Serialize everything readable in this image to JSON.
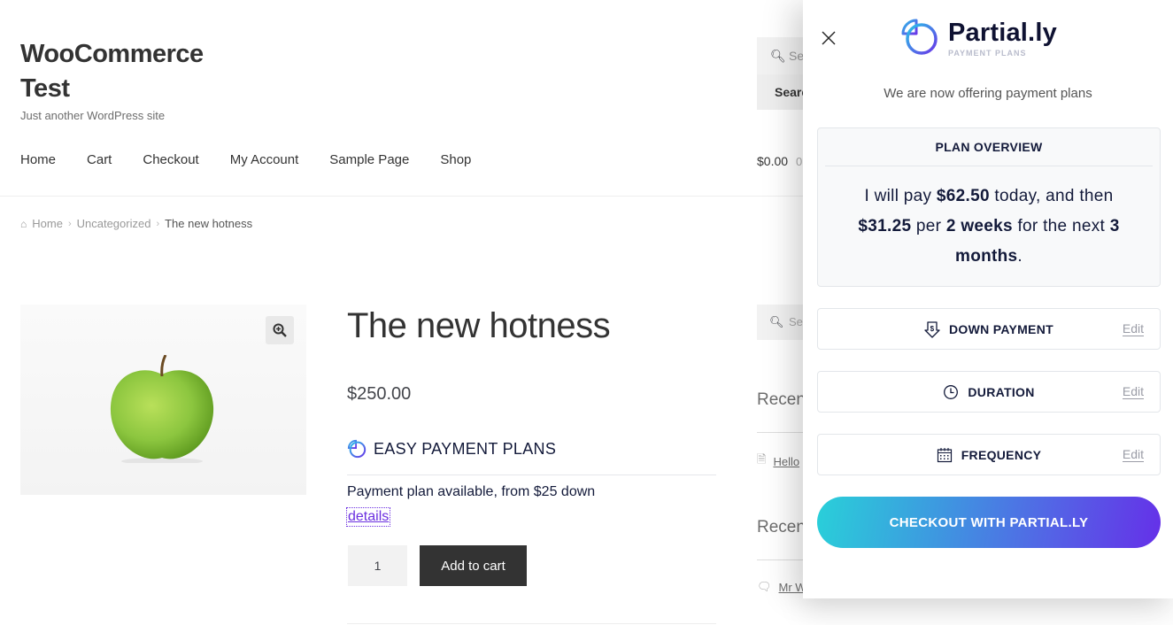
{
  "site": {
    "title": "WooCommerce Test",
    "tagline": "Just another WordPress site",
    "search": {
      "placeholder": "Se",
      "button_label": "Searc"
    },
    "nav": [
      {
        "label": "Home"
      },
      {
        "label": "Cart"
      },
      {
        "label": "Checkout"
      },
      {
        "label": "My Account"
      },
      {
        "label": "Sample Page"
      },
      {
        "label": "Shop"
      }
    ],
    "cart": {
      "total": "$0.00",
      "count": "0"
    }
  },
  "breadcrumb": [
    {
      "label": "Home"
    },
    {
      "label": "Uncategorized"
    },
    {
      "label": "The new hotness"
    }
  ],
  "product": {
    "title": "The new hotness",
    "price": "$250.00",
    "payment_plans": {
      "heading": "EASY PAYMENT PLANS",
      "line": "Payment plan available, from $25 down",
      "details_link": "details"
    },
    "quantity": "1",
    "add_to_cart_label": "Add to cart"
  },
  "sidebar": {
    "search_placeholder": "Se",
    "widgets": [
      {
        "title": "Recent",
        "item": "Hello"
      },
      {
        "title": "Recent",
        "item": "Mr W"
      }
    ]
  },
  "partially": {
    "brand": "Partial.ly",
    "brand_sub": "PAYMENT PLANS",
    "offer_text": "We are now offering payment plans",
    "overview": {
      "heading": "PLAN OVERVIEW",
      "pre": "I will pay ",
      "down_amount": "$62.50",
      "mid": " today, and then ",
      "installment": "$31.25",
      "per": " per ",
      "frequency": "2 weeks",
      "post": " for the next ",
      "duration": "3 months",
      "end": "."
    },
    "options": [
      {
        "label": "DOWN PAYMENT",
        "icon": "down-payment-icon",
        "edit": "Edit"
      },
      {
        "label": "DURATION",
        "icon": "clock-icon",
        "edit": "Edit"
      },
      {
        "label": "FREQUENCY",
        "icon": "calendar-icon",
        "edit": "Edit"
      }
    ],
    "checkout_label": "CHECKOUT WITH PARTIAL.LY",
    "colors": {
      "gradient_start": "#29d0d9",
      "gradient_end": "#6530e8",
      "text_dark": "#131a3a"
    }
  }
}
